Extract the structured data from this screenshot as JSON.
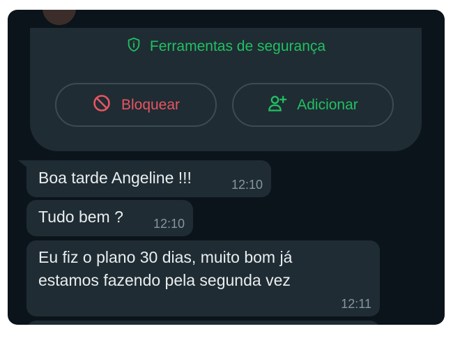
{
  "safety": {
    "label": "Ferramentas de segurança",
    "icon": "shield-icon",
    "color": "#21c063"
  },
  "actions": {
    "block_label": "Bloquear",
    "block_icon": "block-icon",
    "block_color": "#ea5462",
    "add_label": "Adicionar",
    "add_icon": "add-person-icon",
    "add_color": "#21c063"
  },
  "messages": [
    {
      "text": "Boa tarde Angeline !!!",
      "time": "12:10"
    },
    {
      "text": "Tudo bem ?",
      "time": "12:10"
    },
    {
      "lines": [
        "Eu fiz o plano 30 dias, muito bom já",
        "estamos fazendo pela segunda vez"
      ],
      "time": "12:11"
    }
  ]
}
